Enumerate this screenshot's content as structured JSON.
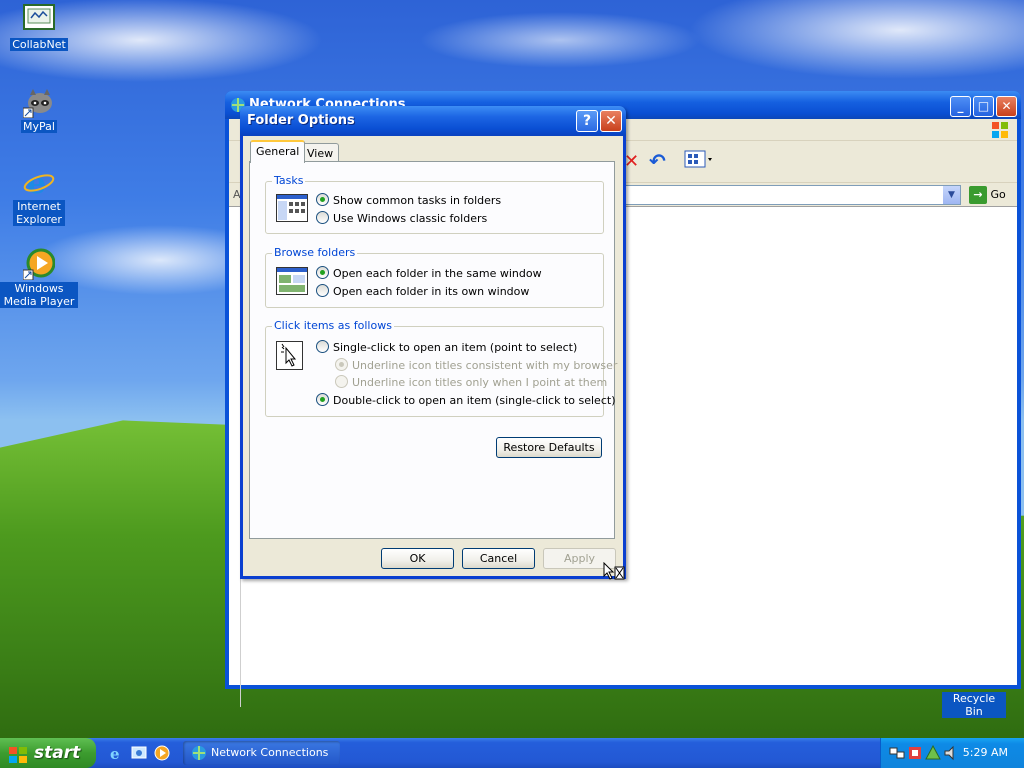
{
  "desktop": {
    "icons": [
      {
        "label": "CollabNet"
      },
      {
        "label": "MyPal"
      },
      {
        "label": "Internet Explorer"
      },
      {
        "label": "Windows Media Player"
      },
      {
        "label": "Recycle Bin"
      }
    ]
  },
  "background_window": {
    "title": "Network Connections",
    "go_label": "Go",
    "address_prefix": "A"
  },
  "dialog": {
    "title": "Folder Options",
    "tabs": [
      {
        "label": "General"
      },
      {
        "label": "View"
      }
    ],
    "groups": {
      "tasks": {
        "title": "Tasks",
        "options": [
          {
            "label": "Show common tasks in folders",
            "selected": true
          },
          {
            "label": "Use Windows classic folders",
            "selected": false
          }
        ]
      },
      "browse": {
        "title": "Browse folders",
        "options": [
          {
            "label": "Open each folder in the same window",
            "selected": true
          },
          {
            "label": "Open each folder in its own window",
            "selected": false
          }
        ]
      },
      "click": {
        "title": "Click items as follows",
        "options": [
          {
            "label": "Single-click to open an item (point to select)",
            "selected": false
          },
          {
            "label": "Underline icon titles consistent with my browser",
            "selected": true,
            "disabled": true
          },
          {
            "label": "Underline icon titles only when I point at them",
            "selected": false,
            "disabled": true
          },
          {
            "label": "Double-click to open an item (single-click to select)",
            "selected": true
          }
        ]
      }
    },
    "restore_defaults_label": "Restore Defaults",
    "ok_label": "OK",
    "cancel_label": "Cancel",
    "apply_label": "Apply"
  },
  "taskbar": {
    "start_label": "start",
    "task_label": "Network Connections",
    "clock": "5:29 AM"
  }
}
